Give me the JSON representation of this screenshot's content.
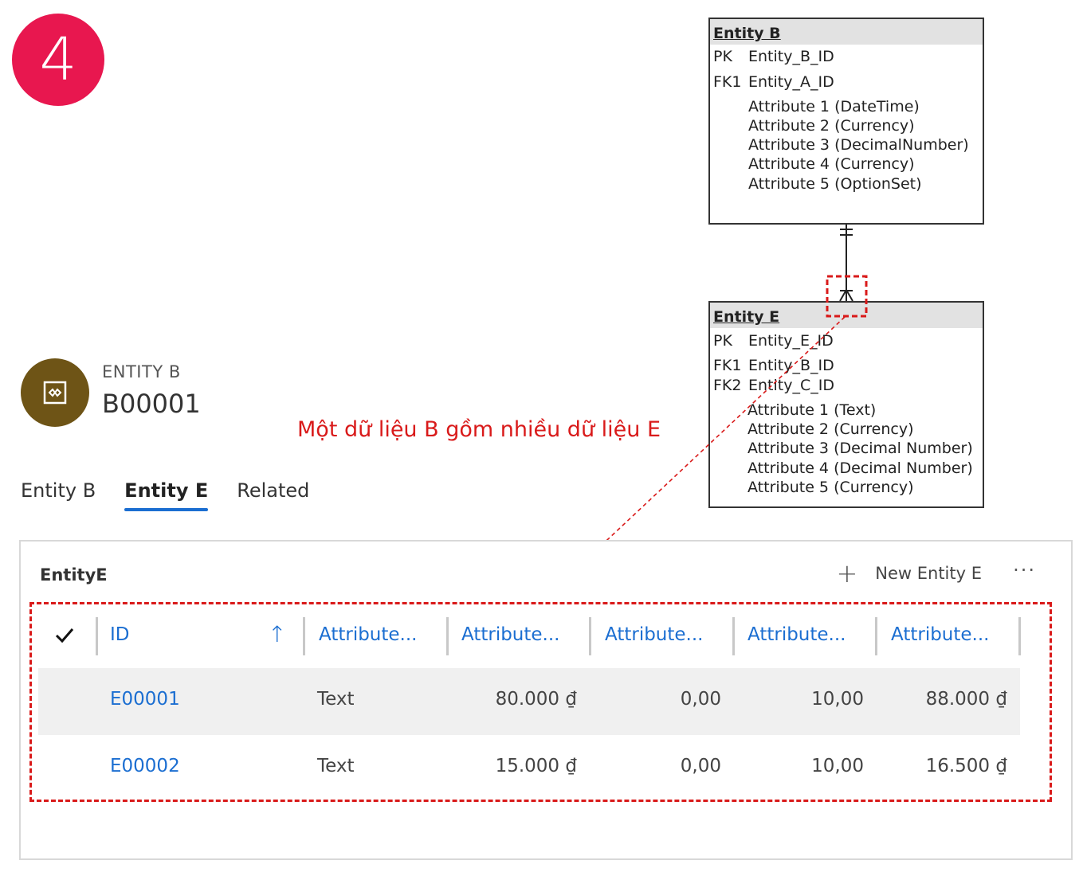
{
  "step_number": "4",
  "erd": {
    "entity_b": {
      "title": "Entity B",
      "pk_key": "PK",
      "pk_field": "Entity_B_ID",
      "fk1_key": "FK1",
      "fk1_field": "Entity_A_ID",
      "attributes": [
        "Attribute 1 (DateTime)",
        "Attribute 2 (Currency)",
        "Attribute 3 (DecimalNumber)",
        "Attribute 4 (Currency)",
        "Attribute 5 (OptionSet)"
      ]
    },
    "entity_e": {
      "title": "Entity E",
      "pk_key": "PK",
      "pk_field": "Entity_E_ID",
      "fk1_key": "FK1",
      "fk1_field": "Entity_B_ID",
      "fk2_key": "FK2",
      "fk2_field": "Entity_C_ID",
      "attributes": [
        "Attribute 1 (Text)",
        "Attribute 2 (Currency)",
        "Attribute 3 (Decimal Number)",
        "Attribute 4 (Decimal Number)",
        "Attribute 5 (Currency)"
      ]
    }
  },
  "annotation": "Một dữ liệu B gồm nhiều dữ liệu E",
  "record": {
    "entity_type": "ENTITY B",
    "id": "B00001"
  },
  "tabs": [
    {
      "label": "Entity B"
    },
    {
      "label": "Entity E"
    },
    {
      "label": "Related"
    }
  ],
  "subgrid": {
    "title": "EntityE",
    "new_button": "New Entity E",
    "more_button": "···",
    "columns": [
      "ID",
      "Attribute...",
      "Attribute...",
      "Attribute...",
      "Attribute...",
      "Attribute..."
    ],
    "rows": [
      {
        "id": "E00001",
        "a1": "Text",
        "a2": "80.000 ₫",
        "a3": "0,00",
        "a4": "10,00",
        "a5": "88.000 ₫"
      },
      {
        "id": "E00002",
        "a1": "Text",
        "a2": "15.000 ₫",
        "a3": "0,00",
        "a4": "10,00",
        "a5": "16.500 ₫"
      }
    ]
  },
  "colors": {
    "badge": "#e8174f",
    "avatar": "#6e5416",
    "accent": "#1b6ed1",
    "annotation": "#d91a1a"
  }
}
